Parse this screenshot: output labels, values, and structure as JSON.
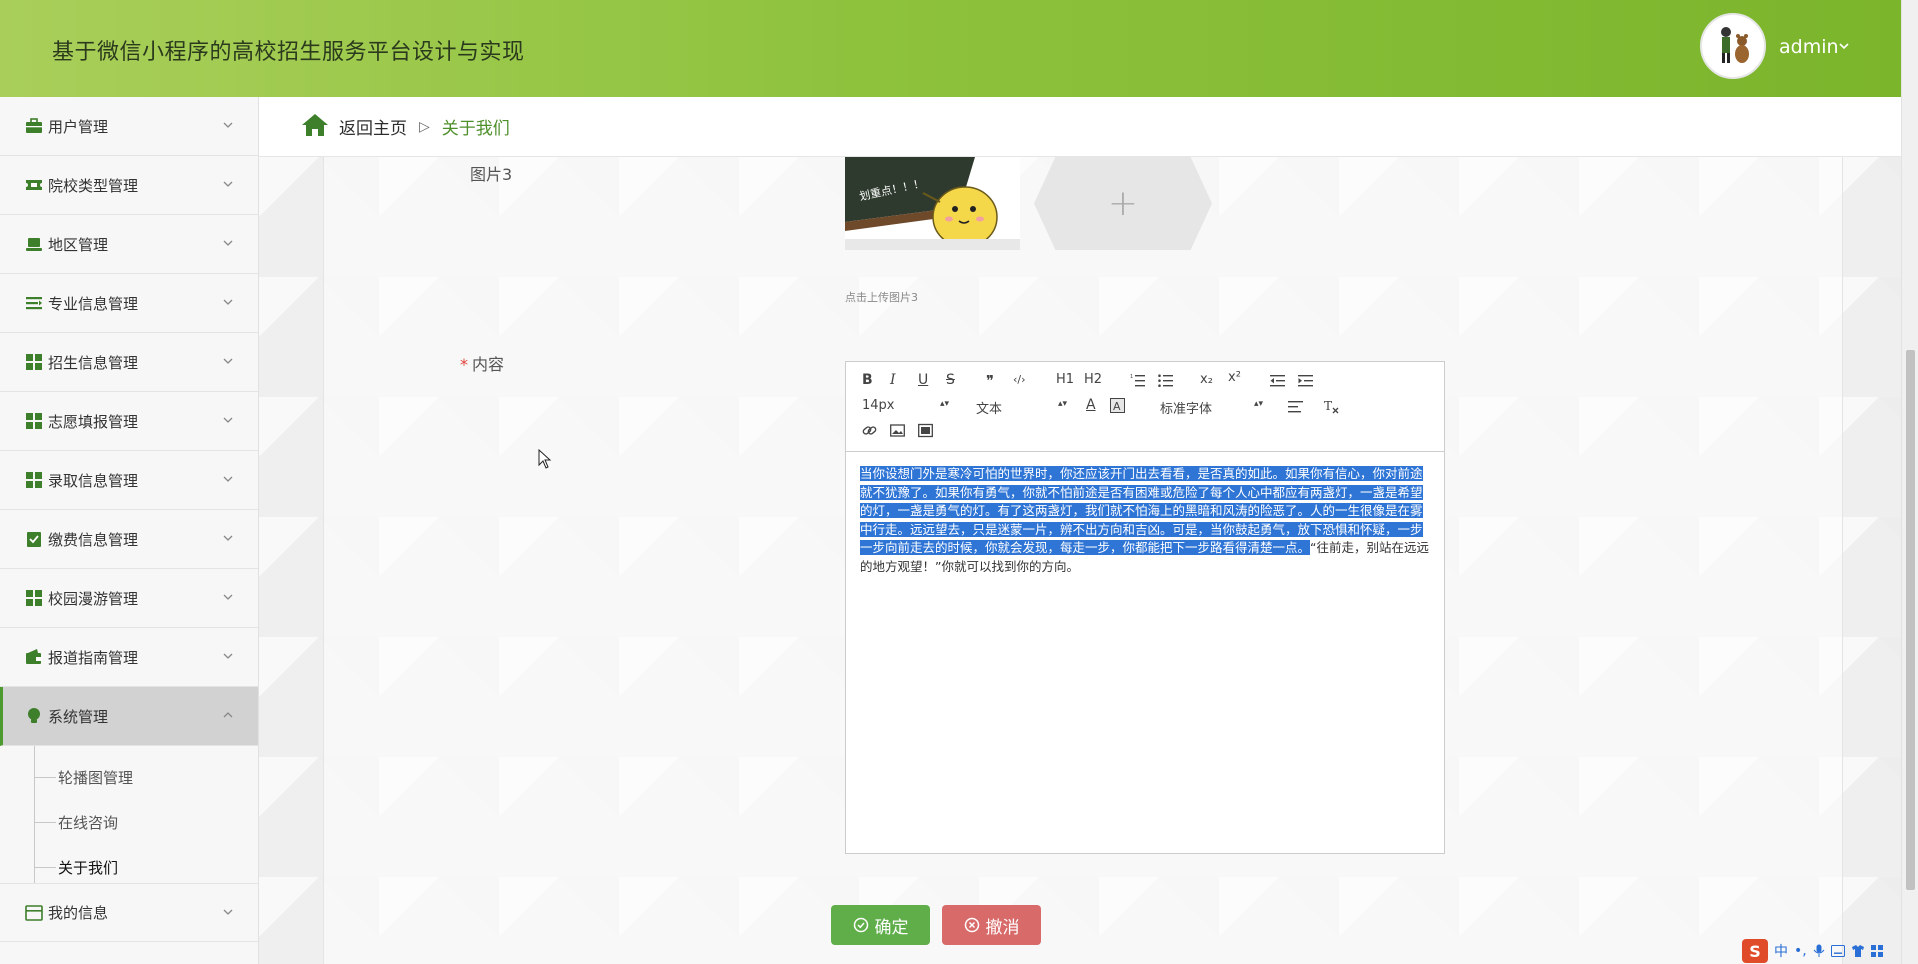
{
  "header": {
    "title": "基于微信小程序的高校招生服务平台设计与实现",
    "user_name": "admin",
    "caret": "⌄"
  },
  "sidebar": {
    "items": [
      {
        "label": "用户管理",
        "icon": "briefcase-icon"
      },
      {
        "label": "院校类型管理",
        "icon": "ticket-icon"
      },
      {
        "label": "地区管理",
        "icon": "laptop-icon"
      },
      {
        "label": "专业信息管理",
        "icon": "list-arrow-icon"
      },
      {
        "label": "招生信息管理",
        "icon": "grid-icon"
      },
      {
        "label": "志愿填报管理",
        "icon": "grid-icon"
      },
      {
        "label": "录取信息管理",
        "icon": "grid-icon"
      },
      {
        "label": "缴费信息管理",
        "icon": "clipboard-check-icon"
      },
      {
        "label": "校园漫游管理",
        "icon": "grid-icon"
      },
      {
        "label": "报道指南管理",
        "icon": "wallet-icon"
      },
      {
        "label": "系统管理",
        "icon": "bulb-icon"
      },
      {
        "label": "我的信息",
        "icon": "id-card-icon"
      }
    ],
    "submenu": [
      "轮播图管理",
      "在线咨询",
      "关于我们"
    ]
  },
  "breadcrumb": {
    "home": "返回主页",
    "separator": "▷",
    "current": "关于我们"
  },
  "form": {
    "image3_label": "图片3",
    "image_banner_text": "划重点！！！",
    "upload_plus": "+",
    "upload_hint": "点击上传图片3",
    "content_required": "*",
    "content_label": "内容"
  },
  "editor": {
    "buttons": {
      "bold": "B",
      "italic": "I",
      "underline": "U",
      "strike": "S",
      "quote": "❞",
      "code": "‹/›",
      "h1": "H1",
      "h2": "H2",
      "sub": "x₂",
      "sup": "x²",
      "color": "A"
    },
    "size_select": "14px",
    "block_select": "文本",
    "font_select": "标准字体",
    "select_arrow": "▴▾",
    "selected_text": "当你设想门外是寒冷可怕的世界时，你还应该开门出去看看，是否真的如此。如果你有信心，你对前途就不犹豫了。如果你有勇气，你就不怕前途是否有困难或危险了每个人心中都应有两盏灯，一盏是希望的灯，一盏是勇气的灯。有了这两盏灯，我们就不怕海上的黑暗和风涛的险恶了。人的一生很像是在雾中行走。远远望去，只是迷蒙一片，辨不出方向和吉凶。可是，当你鼓起勇气，放下恐惧和怀疑，一步一步向前走去的时候，你就会发现，每走一步，你都能把下一步路看得清楚一点。",
    "unselected_text": "“往前走，别站在远远的地方观望！”你就可以找到你的方向。"
  },
  "actions": {
    "confirm": "确定",
    "cancel": "撤消"
  },
  "ime": {
    "logo": "S",
    "lang": "中",
    "punct": "•,"
  },
  "colors": {
    "header_green": "#8ec23d",
    "active_border": "#4d9a31",
    "confirm_green": "#5fae4a",
    "cancel_red": "#d86a6a",
    "selection_blue": "#2f75d6"
  }
}
